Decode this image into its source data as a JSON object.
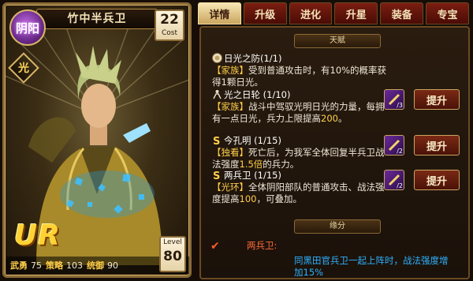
{
  "card": {
    "name": "竹中半兵卫",
    "faction_badge": "阴阳",
    "cost_value": "22",
    "cost_label": "Cost",
    "attribute_badge": "光",
    "rarity": "UR",
    "stats": [
      {
        "label": "武勇",
        "value": "75"
      },
      {
        "label": "策略",
        "value": "103"
      },
      {
        "label": "统御",
        "value": "90"
      }
    ],
    "level_label": "Level",
    "level_value": "80"
  },
  "tabs": [
    {
      "label": "详情",
      "active": true
    },
    {
      "label": "升级",
      "active": false
    },
    {
      "label": "进化",
      "active": false
    },
    {
      "label": "升星",
      "active": false
    },
    {
      "label": "装备",
      "active": false
    },
    {
      "label": "专宝",
      "active": false
    }
  ],
  "talent_header": "天赋",
  "skills": [
    {
      "name": "日光之防(1/1)",
      "icon": "sun-shield-icon",
      "tag": "【家族】",
      "text": "受到普通攻击时，有10%的概率获得1颗日光。"
    },
    {
      "name": "光之日轮 (1/10)",
      "icon": "rider-icon",
      "tag": "【家族】",
      "text": "战斗中驾驭光明日光的力量，每拥有一点日光，兵力上限提高",
      "highlight": "200",
      "suffix": "。",
      "item_icon": "scroll-item-icon",
      "item_count": "/3",
      "button": "提升"
    },
    {
      "name": "今孔明 (1/15)",
      "icon": "s-skill-icon",
      "tag": "【独看】",
      "text": "死亡后，为我军全体回复半兵卫战法强度",
      "highlight": "1.5倍",
      "suffix": "的兵力。",
      "item_icon": "scroll-item-icon",
      "item_count": "/2",
      "button": "提升"
    },
    {
      "name": "两兵卫 (1/15)",
      "icon": "s-skill-icon",
      "tag": "【光环】",
      "text": "全体阴阳部队的普通攻击、战法强度提高",
      "highlight": "100",
      "suffix": "，可叠加。",
      "item_icon": "scroll-item-icon",
      "item_count": "/2",
      "button": "提升"
    }
  ],
  "bond_header": "缘分",
  "bond": {
    "title": "两兵卫:",
    "description": "同黑田官兵卫一起上阵时，战法强度增加15%"
  },
  "colors": {
    "accent_gold": "#d9b56a",
    "tab_red": "#7a1e10",
    "highlight_yellow": "#ffcf4a",
    "bond_blue": "#2fb3ff",
    "bond_orange": "#ff6a3a"
  }
}
